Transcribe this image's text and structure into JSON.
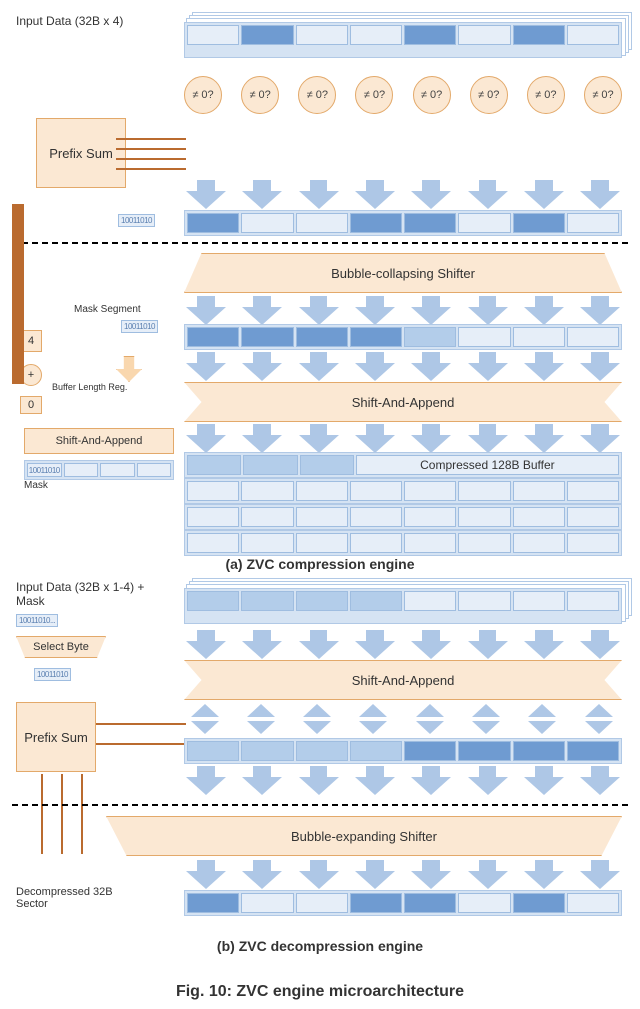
{
  "figure_title": "Fig. 10: ZVC engine microarchitecture",
  "partA": {
    "caption": "(a) ZVC compression engine",
    "input_label": "Input Data (32B x 4)",
    "neq_label": "≠ 0?",
    "prefix_sum": "Prefix Sum",
    "bits1": "10011010",
    "bubble_collapse": "Bubble-collapsing Shifter",
    "mask_segment_label": "Mask Segment",
    "bits2": "10011010",
    "count_box": "4",
    "plus": "+",
    "buffer_len_label": "Buffer Length Reg.",
    "zero_box": "0",
    "shift_append": "Shift-And-Append",
    "shift_append_small": "Shift-And-Append",
    "compressed_buf": "Compressed 128B Buffer",
    "mask_bits": "10011010",
    "mask_label": "Mask"
  },
  "partB": {
    "caption": "(b) ZVC decompression engine",
    "input_label": "Input Data (32B x 1-4) + Mask",
    "mask_bits_in": "10011010...",
    "select_byte": "Select Byte",
    "sel_bits": "10011010",
    "shift_append": "Shift-And-Append",
    "prefix_sum": "Prefix Sum",
    "bubble_expand": "Bubble-expanding Shifter",
    "decomp_label": "Decompressed 32B Sector"
  },
  "chart_data": {
    "type": "diagram",
    "components": [
      {
        "id": "input-a",
        "desc": "4 stacked 32B input sectors (8 words each)"
      },
      {
        "id": "neq0",
        "desc": "8 per-word ≠0 comparators producing mask bits"
      },
      {
        "id": "prefix-sum-a",
        "desc": "Prefix Sum over mask bits"
      },
      {
        "id": "mask-a",
        "desc": "8-bit mask segment, example value 10011010"
      },
      {
        "id": "collapse-shifter",
        "desc": "Bubble-collapsing Shifter compacts nonzero words"
      },
      {
        "id": "count",
        "desc": "Popcount of mask segment, example value 4"
      },
      {
        "id": "adder",
        "desc": "Adds popcount to Buffer Length Reg."
      },
      {
        "id": "buf-len-reg",
        "desc": "Buffer Length Register, shown as 0"
      },
      {
        "id": "shift-append-big",
        "desc": "Shift-And-Append into compressed buffer"
      },
      {
        "id": "shift-append-small",
        "desc": "Shift-And-Append into mask buffer"
      },
      {
        "id": "comp-buf",
        "desc": "Compressed 128B Buffer (4×32B rows)"
      },
      {
        "id": "mask-buf",
        "desc": "Accumulated mask bytes"
      },
      {
        "id": "input-b",
        "desc": "1-4 stacked 32B compressed sectors + mask"
      },
      {
        "id": "select-byte",
        "desc": "Selects one mask byte"
      },
      {
        "id": "prefix-sum-b",
        "desc": "Prefix Sum over selected mask bits"
      },
      {
        "id": "shift-append-b",
        "desc": "Shift-And-Append stages buffer"
      },
      {
        "id": "expand-shifter",
        "desc": "Bubble-expanding Shifter scatters words back"
      },
      {
        "id": "output-b",
        "desc": "Decompressed 32B Sector (8 words)"
      }
    ],
    "example_mask": "10011010",
    "example_popcount": 4,
    "word_width_bytes": 4,
    "sector_bytes": 32,
    "compressed_buffer_bytes": 128
  }
}
